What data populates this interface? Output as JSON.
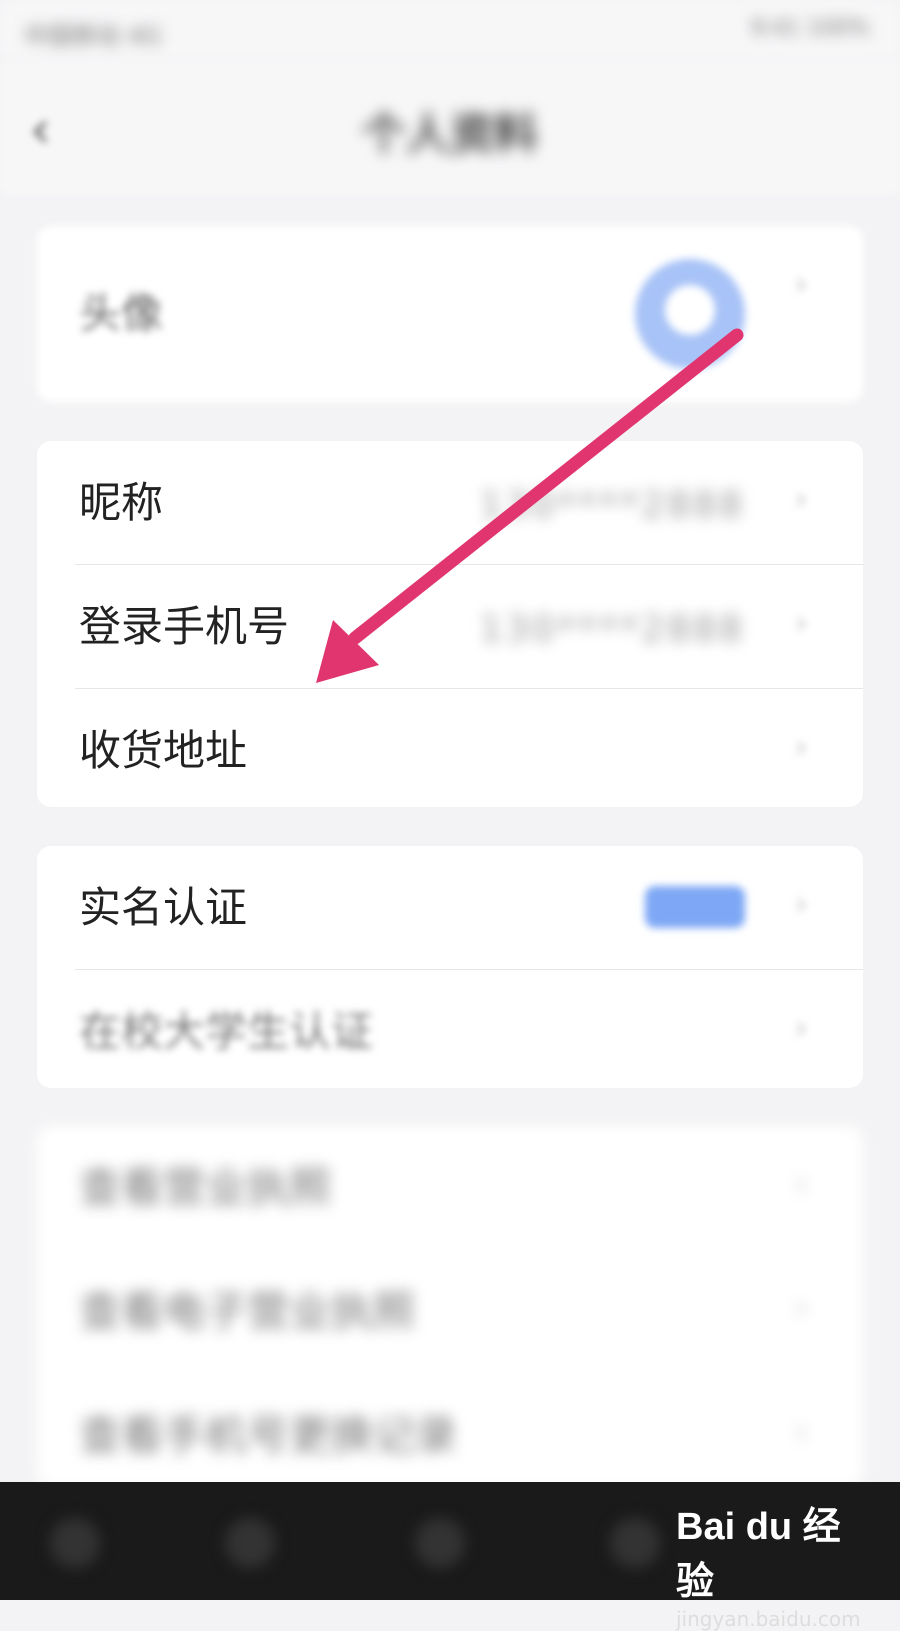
{
  "status_bar": {
    "left": "中国移动 4G",
    "right": "9:41  100%"
  },
  "header": {
    "title": "个人资料",
    "back_icon": "chevron-left-icon"
  },
  "sections": {
    "avatar": {
      "label": "头像",
      "avatar_color": "#a8c3f7"
    },
    "profile": {
      "nickname": {
        "label": "昵称",
        "value": "130****2888"
      },
      "phone": {
        "label": "登录手机号",
        "value": "130****2888"
      },
      "address": {
        "label": "收货地址"
      }
    },
    "verification": {
      "real_name": {
        "label": "实名认证",
        "badge_color": "#7ea8f5"
      },
      "student": {
        "label": "在校大学生认证"
      }
    },
    "more": {
      "item1": {
        "label": "查看营业执照"
      },
      "item2": {
        "label": "查看电子营业执照"
      },
      "item3": {
        "label": "查看手机号更换记录"
      }
    }
  },
  "annotation": {
    "arrow_color": "#e0356f"
  },
  "watermark": {
    "logo": "Bai du 经验",
    "url": "jingyan.baidu.com"
  }
}
